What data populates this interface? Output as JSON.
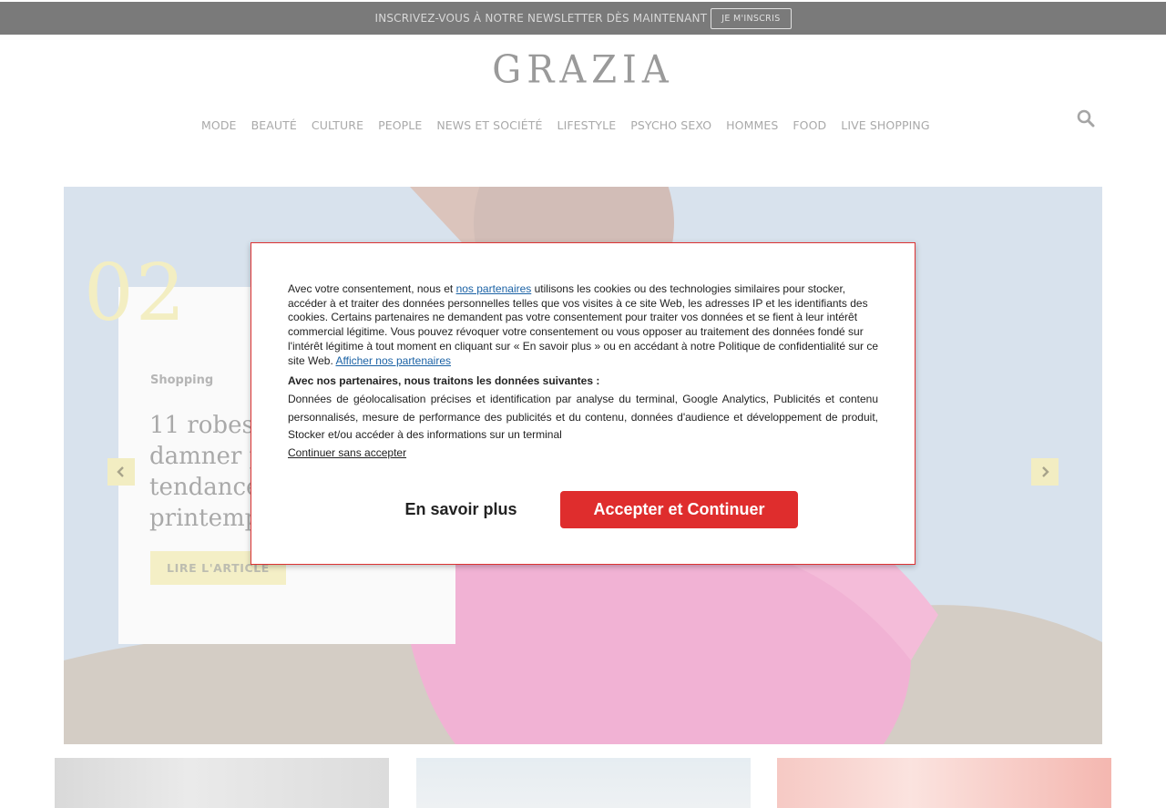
{
  "newsletter": {
    "text": "INSCRIVEZ-VOUS À NOTRE NEWSLETTER DÈS MAINTENANT",
    "button": "JE M'INSCRIS"
  },
  "header": {
    "logo": "GRAZIA",
    "nav": [
      "MODE",
      "BEAUTÉ",
      "CULTURE",
      "PEOPLE",
      "NEWS ET SOCIÉTÉ",
      "LIFESTYLE",
      "PSYCHO SEXO",
      "HOMMES",
      "FOOD",
      "LIVE SHOPPING"
    ],
    "search_icon": "search-icon"
  },
  "hero": {
    "slide_number": "02",
    "category": "Shopping",
    "title": "11 robes fl... damner p... tendance... printemp...",
    "title_lines": [
      "11 robes fl",
      "damner p",
      "tendance",
      "printemp"
    ],
    "cta": "LIRE L'ARTICLE",
    "prev_icon": "chevron-left-icon",
    "next_icon": "chevron-right-icon"
  },
  "cookie": {
    "intro_prefix": "Avec votre consentement, nous et ",
    "partners_link": "nos partenaires",
    "intro_body": " utilisons les cookies ou des technologies similaires pour stocker, accéder à et traiter des données personnelles telles que vos visites à ce site Web, les adresses IP et les identifiants des cookies. Certains partenaires ne demandent pas votre consentement pour traiter vos données et se fient à leur intérêt commercial légitime. Vous pouvez révoquer votre consentement ou vous opposer au traitement des données fondé sur l'intérêt légitime à tout moment en cliquant sur « En savoir plus » ou en accédant à notre Politique de confidentialité sur ce site Web. ",
    "show_partners_link": "Afficher nos partenaires",
    "data_heading": "Avec nos partenaires, nous traitons les données suivantes :",
    "data_list": "Données de géolocalisation précises et identification par analyse du terminal, Google Analytics, Publicités et contenu personnalisés, mesure de performance des publicités et du contenu, données d'audience et développement de produit, Stocker et/ou accéder à des informations sur un terminal",
    "continue_without": "Continuer sans accepter",
    "learn_more": "En savoir plus",
    "accept": "Accepter et Continuer"
  },
  "colors": {
    "accent_red": "#df2d2d",
    "link_blue": "#1b62a5",
    "highlight_yellow": "#f4efc6"
  }
}
